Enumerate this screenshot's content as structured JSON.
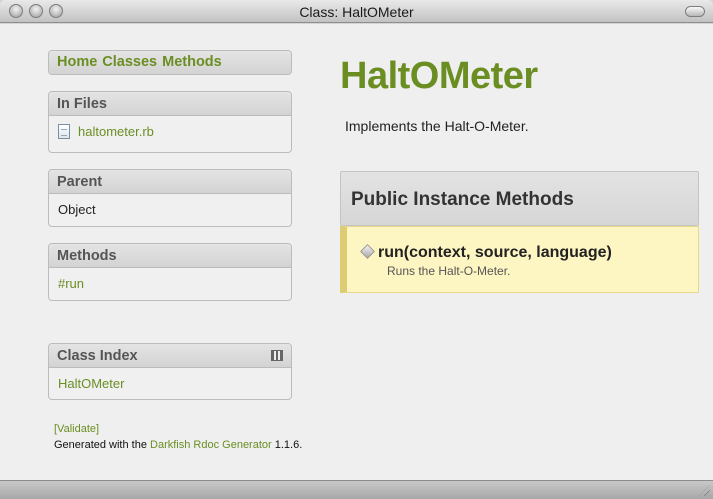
{
  "window": {
    "title": "Class: HaltOMeter"
  },
  "nav": {
    "home": "Home",
    "classes": "Classes",
    "methods": "Methods"
  },
  "in_files": {
    "heading": "In Files",
    "file": "haltometer.rb"
  },
  "parent": {
    "heading": "Parent",
    "value": "Object"
  },
  "methods_panel": {
    "heading": "Methods",
    "item": "#run"
  },
  "class_index": {
    "heading": "Class Index",
    "item": "HaltOMeter"
  },
  "footer": {
    "validate": "[Validate]",
    "generated_prefix": "Generated with the ",
    "generator_link": "Darkfish Rdoc Generator",
    "generated_suffix": " 1.1.6."
  },
  "main": {
    "title": "HaltOMeter",
    "description": "Implements the Halt-O-Meter.",
    "section_heading": "Public Instance Methods",
    "method_signature": "run(context, source, language)",
    "method_description": "Runs the Halt-O-Meter."
  },
  "colors": {
    "accent": "#6b8e23",
    "method_bg": "#fdf5c2"
  }
}
